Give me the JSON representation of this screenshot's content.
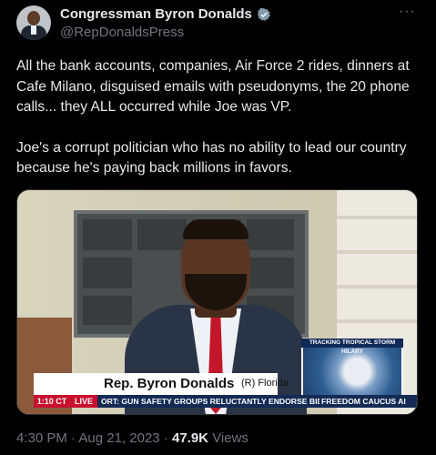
{
  "author": {
    "display_name": "Congressman Byron Donalds",
    "handle": "@RepDonaldsPress"
  },
  "more_label": "···",
  "tweet": {
    "paragraph1": "All the bank accounts, companies, Air Force 2 rides, dinners at Cafe Milano, disguised emails with pseudonyms, the 20 phone calls... they ALL occurred while Joe was VP.",
    "paragraph2": "Joe's a corrupt politician who has no ability to lead our country because he's paying back millions in favors."
  },
  "media": {
    "lower_third_name": "Rep. Byron Donalds",
    "lower_third_party": "(R) Florida",
    "ticker_time": "1:10 CT",
    "ticker_live": "LIVE",
    "ticker_text": "ORT: GUN SAFETY GROUPS RELUCTANTLY ENDORSE BIDEN . . .",
    "ticker_text2": "FREEDOM CAUCUS AI",
    "storm_label": "TRACKING TROPICAL STORM HILARY"
  },
  "meta": {
    "time": "4:30 PM",
    "separator": "·",
    "date": "Aug 21, 2023",
    "views_count": "47.9K",
    "views_label": "Views"
  },
  "colors": {
    "background": "#000000",
    "text": "#e7e9ea",
    "muted": "#71767b",
    "verified": "#829aab"
  }
}
